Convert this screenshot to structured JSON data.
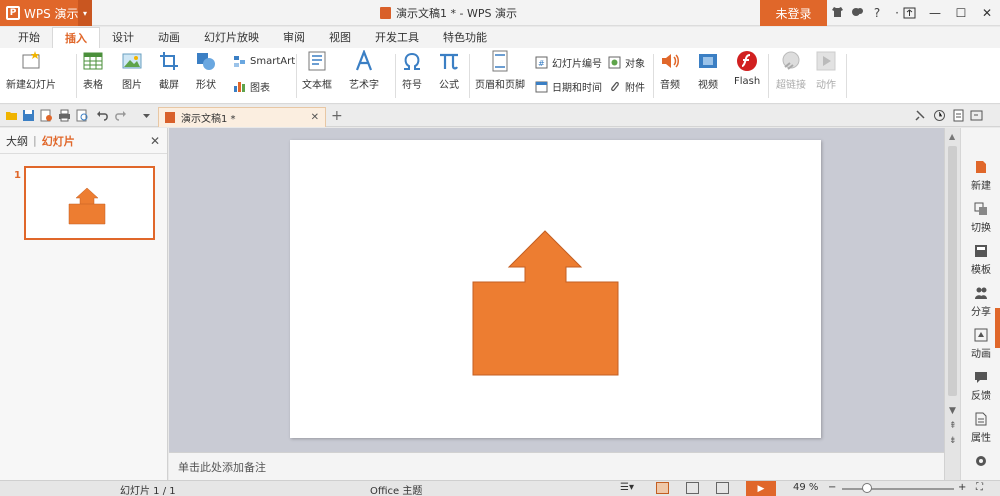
{
  "titlebar": {
    "app_name": "WPS 演示",
    "app_logo": "P",
    "doc_title": "演示文稿1 * - WPS 演示",
    "login_label": "未登录",
    "help_label": "?"
  },
  "tabs": [
    {
      "label": "开始",
      "active": false
    },
    {
      "label": "插入",
      "active": true
    },
    {
      "label": "设计",
      "active": false
    },
    {
      "label": "动画",
      "active": false
    },
    {
      "label": "幻灯片放映",
      "active": false
    },
    {
      "label": "审阅",
      "active": false
    },
    {
      "label": "视图",
      "active": false
    },
    {
      "label": "开发工具",
      "active": false
    },
    {
      "label": "特色功能",
      "active": false
    }
  ],
  "ribbon": {
    "new_slide": "新建幻灯片",
    "table": "表格",
    "picture": "图片",
    "screenshot": "截屏",
    "shape": "形状",
    "smartart": "SmartArt",
    "chart": "图表",
    "textbox": "文本框",
    "wordart": "艺术字",
    "symbol": "符号",
    "formula": "公式",
    "header_footer": "页眉和页脚",
    "slide_number": "幻灯片编号",
    "object": "对象",
    "datetime": "日期和时间",
    "attachment": "附件",
    "audio": "音频",
    "video": "视频",
    "flash": "Flash",
    "hyperlink": "超链接",
    "action": "动作"
  },
  "doc_tab": {
    "label": "演示文稿1 *"
  },
  "left_panel": {
    "outline_tab": "大纲",
    "slides_tab": "幻灯片",
    "divider": "|",
    "slide_number": "1"
  },
  "notes": {
    "placeholder": "单击此处添加备注"
  },
  "right_panel": [
    {
      "label": "新建"
    },
    {
      "label": "切换"
    },
    {
      "label": "模板"
    },
    {
      "label": "分享"
    },
    {
      "label": "动画"
    },
    {
      "label": "反馈"
    },
    {
      "label": "属性"
    }
  ],
  "status": {
    "slide_info": "幻灯片 1 / 1",
    "theme": "Office 主题",
    "zoom": "49 %",
    "zoom_fraction": 0.49
  },
  "colors": {
    "accent": "#e0672a",
    "shape_fill": "#ed7d31",
    "shape_stroke": "#c35e22"
  },
  "slide_shape": {
    "type": "up-arrow-callout",
    "icon": "up-arrow-callout-shape"
  }
}
